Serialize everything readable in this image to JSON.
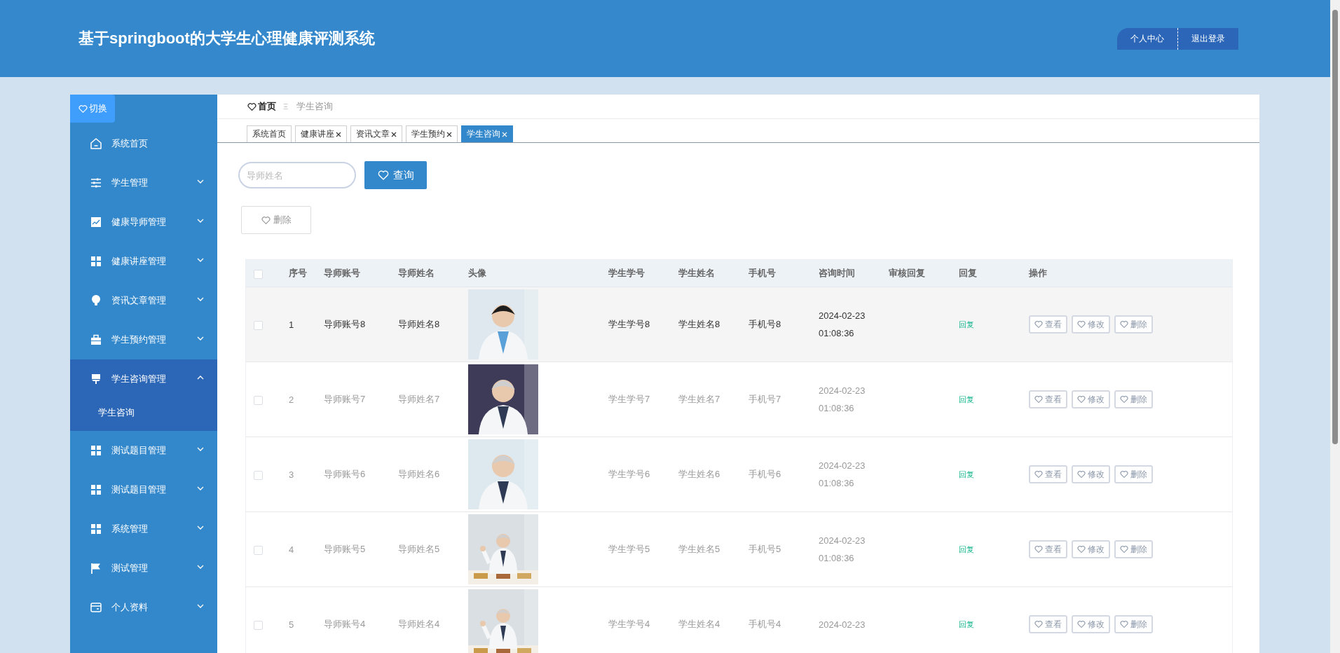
{
  "header": {
    "title": "基于springboot的大学生心理健康评测系统",
    "buttons": [
      "个人中心",
      "退出登录"
    ]
  },
  "sidebar": {
    "toggle": "切换",
    "items": [
      {
        "kind": "link",
        "label": "系统首页",
        "selected": false
      },
      {
        "kind": "submenu",
        "label": "学生管理",
        "expanded": false
      },
      {
        "kind": "submenu",
        "label": "健康导师管理",
        "expanded": false
      },
      {
        "kind": "submenu",
        "label": "健康讲座管理",
        "expanded": false
      },
      {
        "kind": "submenu",
        "label": "资讯文章管理",
        "expanded": false
      },
      {
        "kind": "submenu",
        "label": "学生预约管理",
        "expanded": false
      },
      {
        "kind": "submenu",
        "label": "学生咨询管理",
        "expanded": true,
        "children": [
          {
            "label": "学生咨询",
            "selected": true
          }
        ]
      },
      {
        "kind": "submenu",
        "label": "测试题目管理",
        "expanded": false
      },
      {
        "kind": "submenu",
        "label": "测试题目管理",
        "expanded": false
      },
      {
        "kind": "submenu",
        "label": "系统管理",
        "expanded": false
      },
      {
        "kind": "submenu",
        "label": "测试管理",
        "expanded": false
      },
      {
        "kind": "submenu",
        "label": "个人资料",
        "expanded": false
      }
    ]
  },
  "breadcrumb": {
    "home": "首页",
    "separator": "Ξ",
    "current": "学生咨询"
  },
  "tabs": [
    {
      "label": "系统首页",
      "selected": false,
      "closable": false
    },
    {
      "label": "健康讲座",
      "selected": false,
      "closable": true
    },
    {
      "label": "资讯文章",
      "selected": false,
      "closable": true
    },
    {
      "label": "学生预约",
      "selected": false,
      "closable": true
    },
    {
      "label": "学生咨询",
      "selected": true,
      "closable": true
    }
  ],
  "search": {
    "placeholder": "导师姓名",
    "button": "查询"
  },
  "delete_button": "删除",
  "table": {
    "header_checked": false,
    "columns": [
      "序号",
      "导师账号",
      "导师姓名",
      "头像",
      "学生学号",
      "学生姓名",
      "手机号",
      "咨询时间",
      "审核回复",
      "回复",
      "操作"
    ],
    "rows": [
      {
        "hovered": true,
        "checked": false,
        "no": "1",
        "tutor_account": "导师账号8",
        "tutor_name": "导师姓名8",
        "student_no": "学生学号8",
        "student_name": "学生姓名8",
        "phone": "手机号8",
        "time": "2024-02-23 01:08:36",
        "reply": "回复",
        "actions": [
          "查看",
          "修改",
          "删除"
        ]
      },
      {
        "hovered": false,
        "checked": false,
        "no": "2",
        "tutor_account": "导师账号7",
        "tutor_name": "导师姓名7",
        "student_no": "学生学号7",
        "student_name": "学生姓名7",
        "phone": "手机号7",
        "time": "2024-02-23 01:08:36",
        "reply": "回复",
        "actions": [
          "查看",
          "修改",
          "删除"
        ]
      },
      {
        "hovered": false,
        "checked": false,
        "no": "3",
        "tutor_account": "导师账号6",
        "tutor_name": "导师姓名6",
        "student_no": "学生学号6",
        "student_name": "学生姓名6",
        "phone": "手机号6",
        "time": "2024-02-23 01:08:36",
        "reply": "回复",
        "actions": [
          "查看",
          "修改",
          "删除"
        ]
      },
      {
        "hovered": false,
        "checked": false,
        "no": "4",
        "tutor_account": "导师账号5",
        "tutor_name": "导师姓名5",
        "student_no": "学生学号5",
        "student_name": "学生姓名5",
        "phone": "手机号5",
        "time": "2024-02-23 01:08:36",
        "reply": "回复",
        "actions": [
          "查看",
          "修改",
          "删除"
        ]
      },
      {
        "hovered": false,
        "checked": false,
        "no": "5",
        "tutor_account": "导师账号4",
        "tutor_name": "导师姓名4",
        "student_no": "学生学号4",
        "student_name": "学生姓名4",
        "phone": "手机号4",
        "time": "2024-02-23",
        "reply": "回复",
        "actions": [
          "查看",
          "修改",
          "删除"
        ]
      }
    ]
  }
}
